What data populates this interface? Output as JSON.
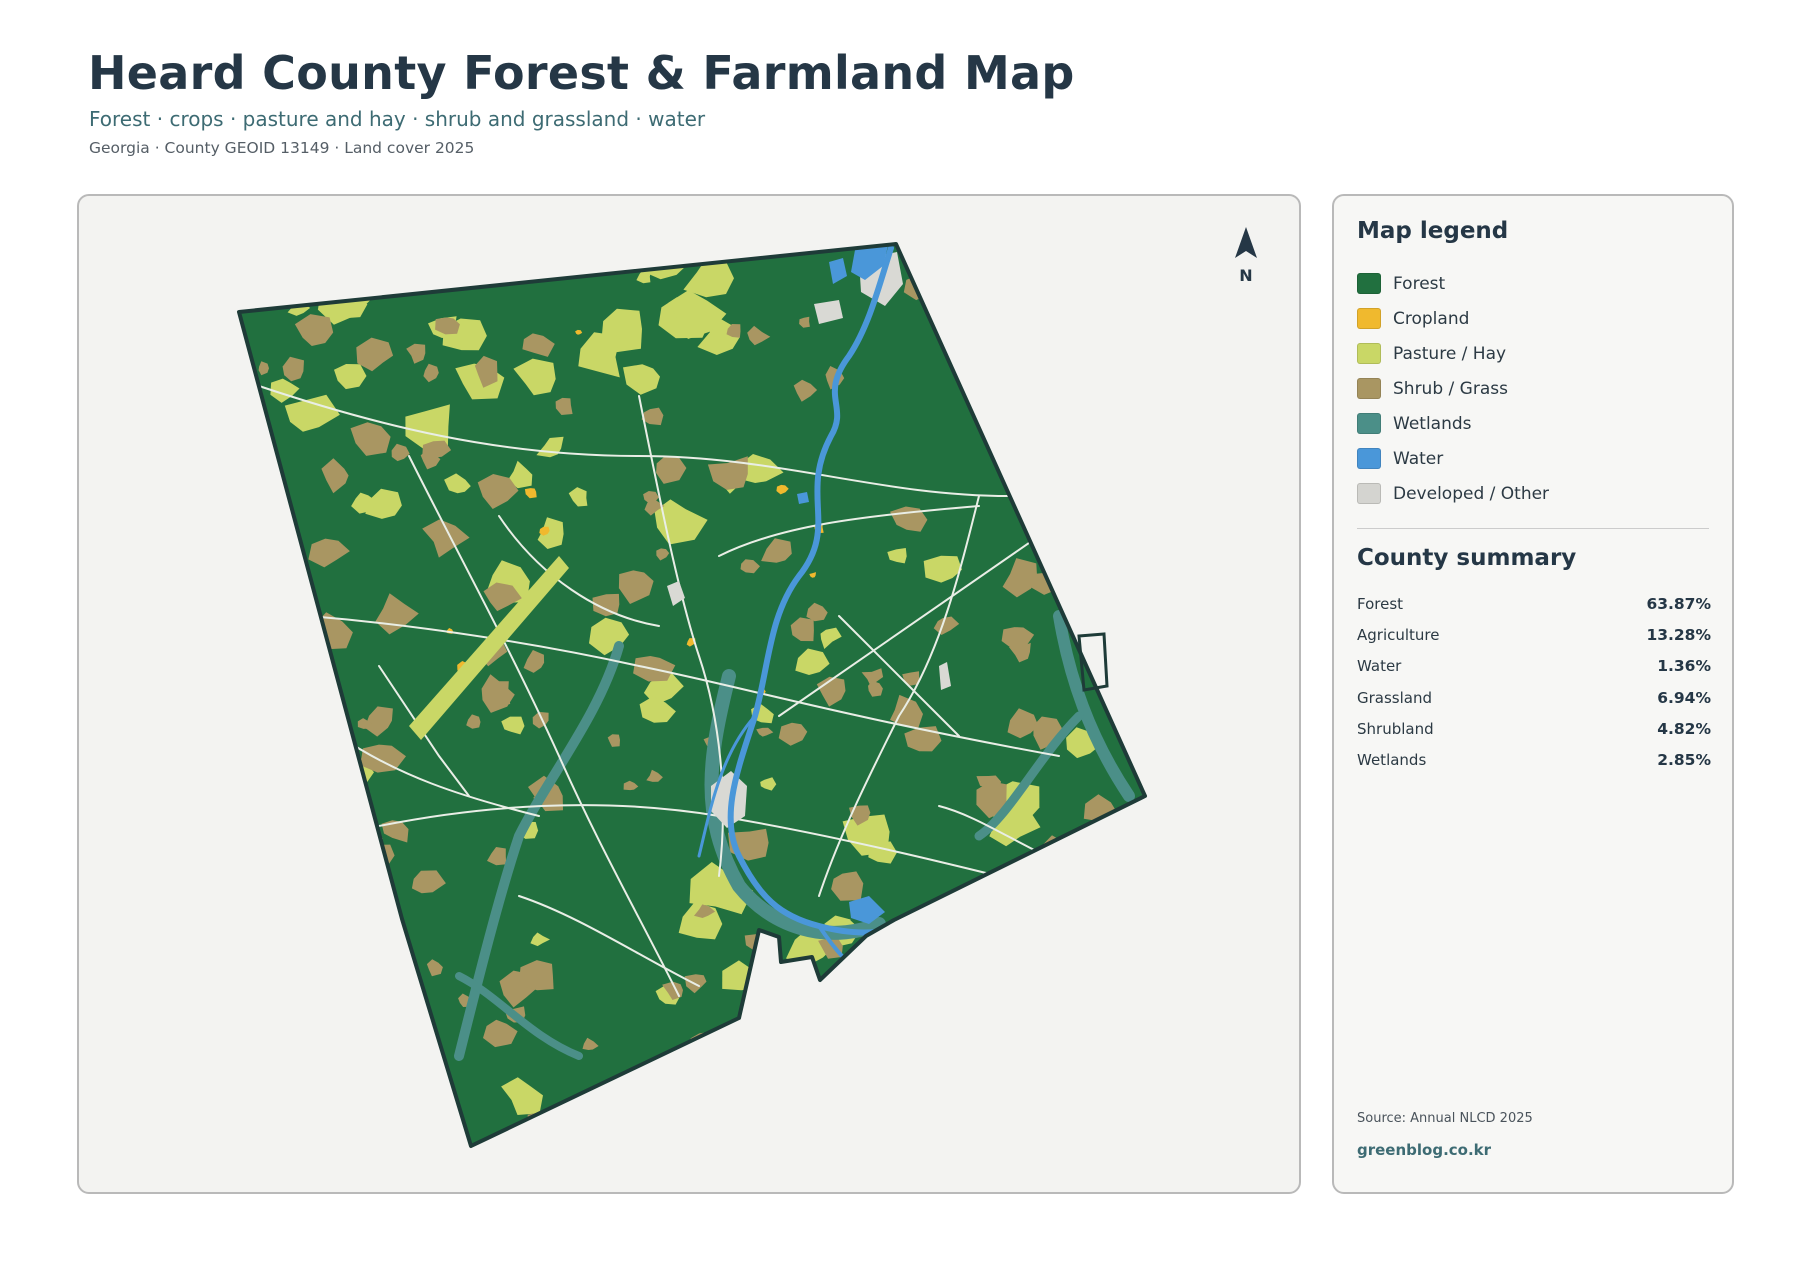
{
  "header": {
    "title": "Heard County Forest & Farmland Map",
    "subtitle": "Forest · crops · pasture and hay · shrub and grassland · water",
    "meta": "Georgia · County GEOID 13149 · Land cover 2025"
  },
  "map": {
    "north_label": "N",
    "colors": {
      "forest": "#21703f",
      "cropland": "#f0b92e",
      "pasture": "#c9d766",
      "shrub": "#a99662",
      "wetlands": "#4b8f88",
      "water": "#4a97d9",
      "developed": "#d9d9d4",
      "boundary": "#1e3b38",
      "background": "#f3f3f1"
    }
  },
  "legend": {
    "title": "Map legend",
    "items": [
      {
        "label": "Forest",
        "color": "#21703f"
      },
      {
        "label": "Cropland",
        "color": "#f0b92e"
      },
      {
        "label": "Pasture / Hay",
        "color": "#c9d766"
      },
      {
        "label": "Shrub / Grass",
        "color": "#a99662"
      },
      {
        "label": "Wetlands",
        "color": "#4b8f88"
      },
      {
        "label": "Water",
        "color": "#4a97d9"
      },
      {
        "label": "Developed / Other",
        "color": "#d4d4d0"
      }
    ]
  },
  "summary": {
    "title": "County summary",
    "rows": [
      {
        "label": "Forest",
        "value": "63.87%"
      },
      {
        "label": "Agriculture",
        "value": "13.28%"
      },
      {
        "label": "Water",
        "value": "1.36%"
      },
      {
        "label": "Grassland",
        "value": "6.94%"
      },
      {
        "label": "Shrubland",
        "value": "4.82%"
      },
      {
        "label": "Wetlands",
        "value": "2.85%"
      }
    ]
  },
  "footer": {
    "source": "Source: Annual NLCD 2025",
    "credit": "greenblog.co.kr"
  }
}
